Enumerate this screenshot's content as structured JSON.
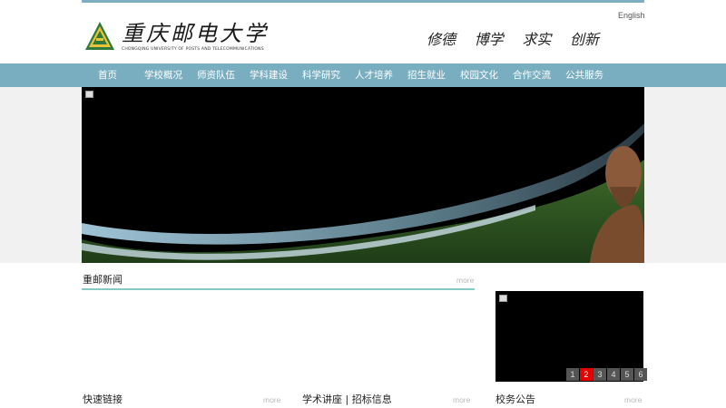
{
  "header": {
    "logo_cn": "重庆邮电大学",
    "logo_en": "CHONGQING UNIVERSITY OF POSTS AND TELECOMMUNICATIONS",
    "english_link": "English",
    "motto": [
      "修德",
      "博学",
      "求实",
      "创新"
    ]
  },
  "nav": {
    "items": [
      "首页",
      "学校概况",
      "师资队伍",
      "学科建设",
      "科学研究",
      "人才培养",
      "招生就业",
      "校园文化",
      "合作交流",
      "公共服务"
    ]
  },
  "news": {
    "title": "重邮新闻",
    "more": "more"
  },
  "slider": {
    "pages": [
      "1",
      "2",
      "3",
      "4",
      "5",
      "6"
    ],
    "active_page": 2
  },
  "bottom": {
    "quick_links": {
      "title": "快速链接",
      "more": "more"
    },
    "lectures": {
      "title": "学术讲座 | 招标信息",
      "more": "more"
    },
    "affairs": {
      "title": "校务公告",
      "more": "more"
    }
  },
  "colors": {
    "nav_bg": "#79aec0",
    "news_underline": "#87c9c3",
    "pager_active": "#e60000"
  }
}
